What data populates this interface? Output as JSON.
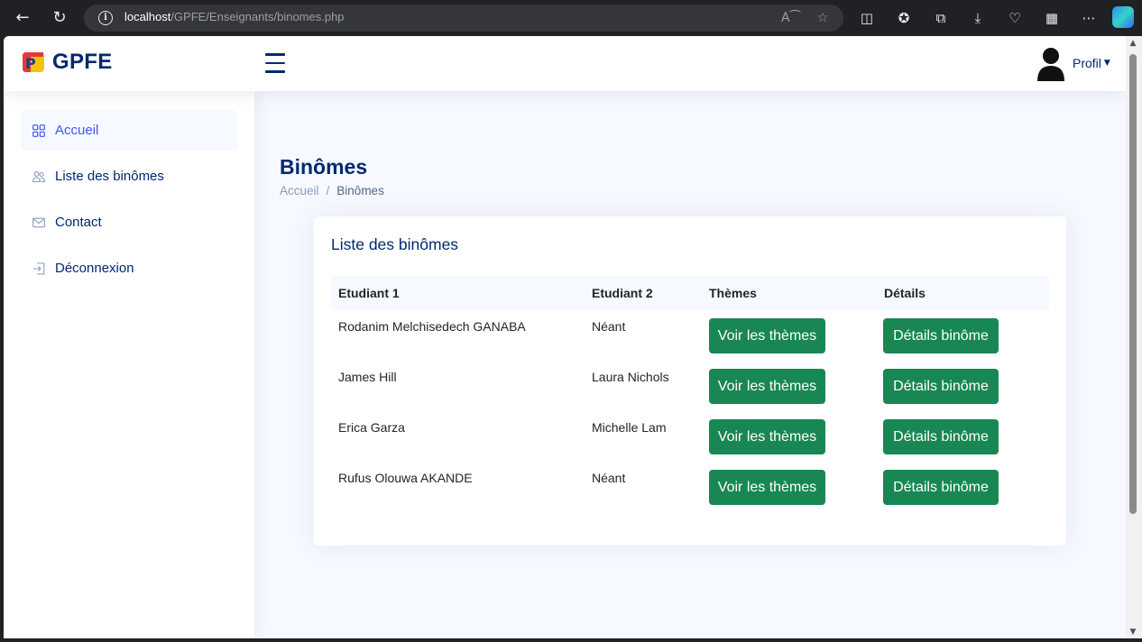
{
  "browser": {
    "url_host": "localhost",
    "url_path": "/GPFE/Enseignants/binomes.php"
  },
  "header": {
    "app_name": "GPFE",
    "profile_label": "Profil"
  },
  "sidebar": {
    "items": [
      {
        "label": "Accueil",
        "icon": "grid-icon",
        "active": true
      },
      {
        "label": "Liste des binômes",
        "icon": "people-icon",
        "active": false
      },
      {
        "label": "Contact",
        "icon": "envelope-icon",
        "active": false
      },
      {
        "label": "Déconnexion",
        "icon": "logout-icon",
        "active": false
      }
    ]
  },
  "main": {
    "page_title": "Binômes",
    "breadcrumb": [
      "Accueil",
      "Binômes"
    ],
    "card_title": "Liste des binômes",
    "table": {
      "headers": [
        "Etudiant 1",
        "Etudiant 2",
        "Thèmes",
        "Détails"
      ],
      "rows": [
        {
          "etudiant1": "Rodanim Melchisedech GANABA",
          "etudiant2": "Néant",
          "themes_button": "Voir les thèmes",
          "details_button": "Détails binôme"
        },
        {
          "etudiant1": "James Hill",
          "etudiant2": "Laura Nichols",
          "themes_button": "Voir les thèmes",
          "details_button": "Détails binôme"
        },
        {
          "etudiant1": "Erica Garza",
          "etudiant2": "Michelle Lam",
          "themes_button": "Voir les thèmes",
          "details_button": "Détails binôme"
        },
        {
          "etudiant1": "Rufus Olouwa AKANDE",
          "etudiant2": "Néant",
          "themes_button": "Voir les thèmes",
          "details_button": "Détails binôme"
        }
      ]
    }
  },
  "colors": {
    "brand": "#012970",
    "accent": "#4154f1",
    "button_success": "#198754",
    "page_background": "#f6f9ff"
  }
}
